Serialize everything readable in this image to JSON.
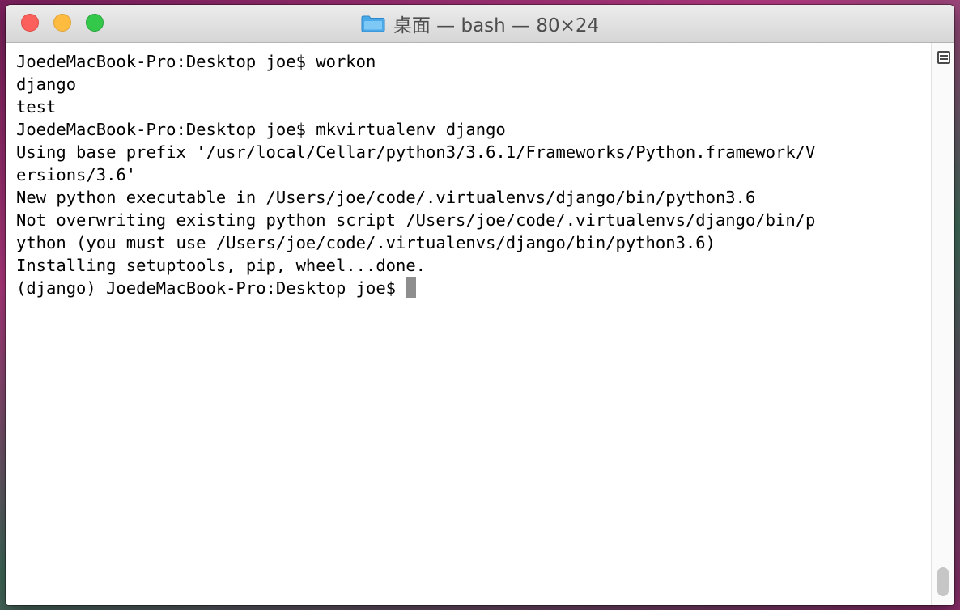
{
  "window": {
    "title": "桌面 — bash — 80×24",
    "folder_icon": "folder-icon",
    "traffic_lights": {
      "close_color": "#fc605c",
      "minimize_color": "#fdbc40",
      "zoom_color": "#34c84a"
    }
  },
  "terminal": {
    "lines": [
      "JoedeMacBook-Pro:Desktop joe$ workon",
      "django",
      "test",
      "JoedeMacBook-Pro:Desktop joe$ mkvirtualenv django",
      "Using base prefix '/usr/local/Cellar/python3/3.6.1/Frameworks/Python.framework/V",
      "ersions/3.6'",
      "New python executable in /Users/joe/code/.virtualenvs/django/bin/python3.6",
      "Not overwriting existing python script /Users/joe/code/.virtualenvs/django/bin/p",
      "ython (you must use /Users/joe/code/.virtualenvs/django/bin/python3.6)",
      "Installing setuptools, pip, wheel...done.",
      "(django) JoedeMacBook-Pro:Desktop joe$"
    ],
    "cursor_color": "#8e8e8e"
  },
  "scrollbar": {
    "split_icon": "split-pane-icon"
  }
}
